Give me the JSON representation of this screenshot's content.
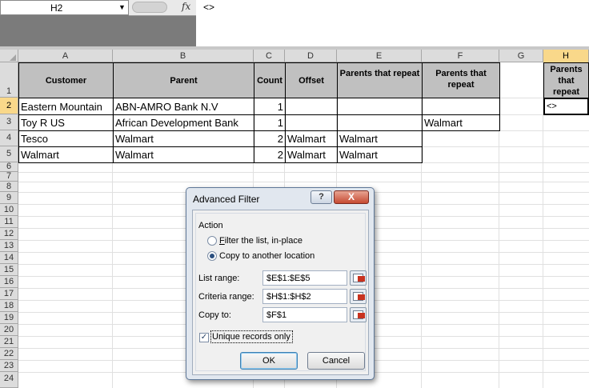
{
  "formula_bar": {
    "name_box": "H2",
    "fx_label": "fx",
    "formula": "<>"
  },
  "columns": [
    "A",
    "B",
    "C",
    "D",
    "E",
    "F",
    "G",
    "H"
  ],
  "active_column": "H",
  "rows": [
    "1",
    "2",
    "3",
    "4",
    "5",
    "6",
    "7",
    "8",
    "9",
    "10",
    "11",
    "12",
    "13",
    "14",
    "15",
    "16",
    "17",
    "18",
    "19",
    "20",
    "21",
    "22",
    "23",
    "24"
  ],
  "active_row": "2",
  "sheet": {
    "headers": {
      "customer": "Customer",
      "parent": "Parent",
      "count": "Count",
      "offset": "Offset",
      "repeat_e": "Parents that repeat",
      "repeat_f": "Parents that repeat",
      "repeat_h": "Parents that repeat"
    },
    "data": [
      {
        "customer": "Eastern Mountain",
        "parent": "ABN-AMRO Bank N.V",
        "count": "1",
        "offset": "",
        "repeat": "",
        "f": ""
      },
      {
        "customer": "Toy R US",
        "parent": "African Development Bank",
        "count": "1",
        "offset": "",
        "repeat": "",
        "f": "Walmart"
      },
      {
        "customer": "Tesco",
        "parent": "Walmart",
        "count": "2",
        "offset": "Walmart",
        "repeat": "Walmart",
        "f": ""
      },
      {
        "customer": "Walmart",
        "parent": "Walmart",
        "count": "2",
        "offset": "Walmart",
        "repeat": "Walmart",
        "f": ""
      }
    ],
    "h2": "<>"
  },
  "dialog": {
    "title": "Advanced Filter",
    "help": "?",
    "close": "X",
    "group_label": "Action",
    "radio_filter": {
      "first": "F",
      "rest": "ilter the list, in-place",
      "selected": false
    },
    "radio_copy": {
      "first": "O",
      "rest": "Copy to another location",
      "selected": true
    },
    "list_range": {
      "label": "List range:",
      "value": "$E$1:$E$5"
    },
    "criteria_range": {
      "label": "Criteria range:",
      "value": "$H$1:$H$2"
    },
    "copy_to": {
      "label": "Copy to:",
      "value": "$F$1"
    },
    "unique": {
      "label": "Unique records only",
      "checked": true
    },
    "ok": "OK",
    "cancel": "Cancel"
  }
}
